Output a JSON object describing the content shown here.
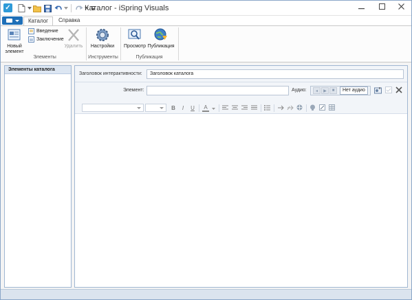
{
  "window": {
    "title": "Каталог - iSpring Visuals",
    "minimize_icon": "minimize-icon",
    "maximize_icon": "maximize-icon",
    "close_icon": "close-icon"
  },
  "ribbon": {
    "tabs": [
      {
        "label": "Каталог",
        "active": true
      },
      {
        "label": "Справка",
        "active": false
      }
    ],
    "groups": {
      "elements": {
        "label": "Элементы",
        "new_element": "Новый элемент",
        "intro": "Введение",
        "conclusion": "Заключение",
        "delete": "Удалить"
      },
      "tools": {
        "label": "Инструменты",
        "settings": "Настройки"
      },
      "publish": {
        "label": "Публикация",
        "preview": "Просмотр",
        "publish": "Публикация"
      }
    }
  },
  "left_panel": {
    "header": "Элементы каталога"
  },
  "editor": {
    "title_label": "Заголовок интерактивности:",
    "title_value": "Заголовок каталога",
    "element_label": "Элемент:",
    "element_value": "",
    "audio_label": "Аудио:",
    "no_audio": "Нет аудио"
  },
  "colors": {
    "accent": "#1e6fb8",
    "panel_border": "#9fb6d2",
    "header_bg": "#dce6f2"
  }
}
